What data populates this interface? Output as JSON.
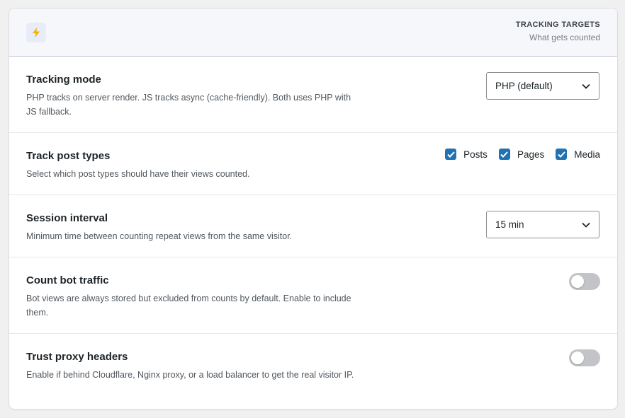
{
  "header": {
    "icon": "lightning-bolt-icon",
    "title": "TRACKING TARGETS",
    "subtitle": "What gets counted"
  },
  "settings": [
    {
      "title": "Tracking mode",
      "description": "PHP tracks on server render. JS tracks async (cache-friendly). Both uses PHP with JS fallback.",
      "control": "select",
      "value": "PHP (default)"
    },
    {
      "title": "Track post types",
      "description": "Select which post types should have their views counted.",
      "control": "checkboxes",
      "options": [
        {
          "label": "Posts",
          "checked": true
        },
        {
          "label": "Pages",
          "checked": true
        },
        {
          "label": "Media",
          "checked": true
        }
      ]
    },
    {
      "title": "Session interval",
      "description": "Minimum time between counting repeat views from the same visitor.",
      "control": "select",
      "value": "15 min"
    },
    {
      "title": "Count bot traffic",
      "description": "Bot views are always stored but excluded from counts by default. Enable to include them.",
      "control": "toggle",
      "enabled": false
    },
    {
      "title": "Trust proxy headers",
      "description": "Enable if behind Cloudflare, Nginx proxy, or a load balancer to get the real visitor IP.",
      "control": "toggle",
      "enabled": false
    }
  ],
  "colors": {
    "accent": "#2271b1",
    "icon": "#f0b400",
    "toggle_off": "#c3c4c7"
  }
}
